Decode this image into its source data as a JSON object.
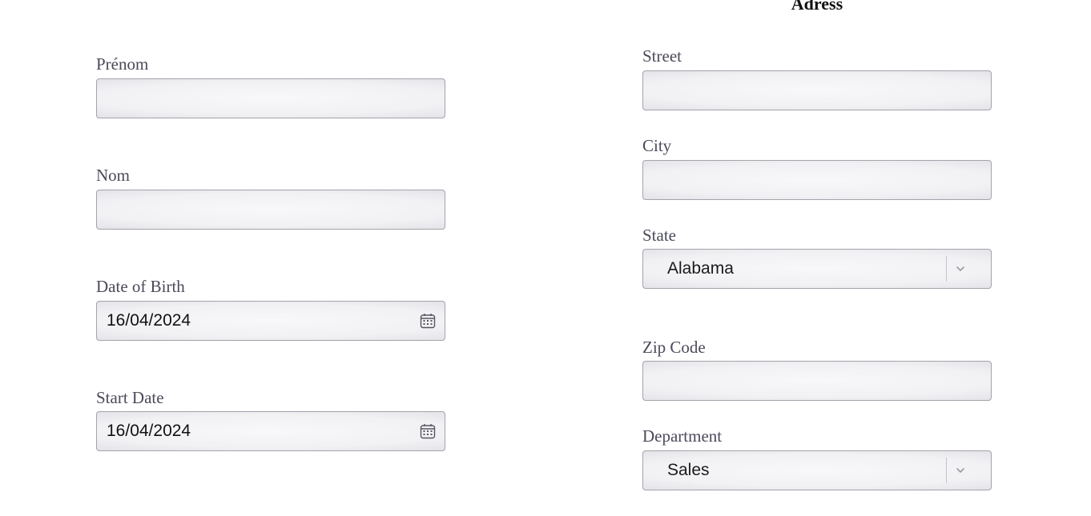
{
  "address_section": {
    "title": "Adress"
  },
  "left_form": {
    "first_name": {
      "label": "Prénom",
      "value": ""
    },
    "last_name": {
      "label": "Nom",
      "value": ""
    },
    "date_of_birth": {
      "label": "Date of Birth",
      "value": "16/04/2024",
      "icon": "calendar-icon"
    },
    "start_date": {
      "label": "Start Date",
      "value": "16/04/2024",
      "icon": "calendar-icon"
    }
  },
  "right_form": {
    "street": {
      "label": "Street",
      "value": ""
    },
    "city": {
      "label": "City",
      "value": ""
    },
    "state": {
      "label": "State",
      "selected": "Alabama",
      "icon": "chevron-down-icon"
    },
    "zip_code": {
      "label": "Zip Code",
      "value": ""
    },
    "department": {
      "label": "Department",
      "selected": "Sales",
      "icon": "chevron-down-icon"
    }
  }
}
